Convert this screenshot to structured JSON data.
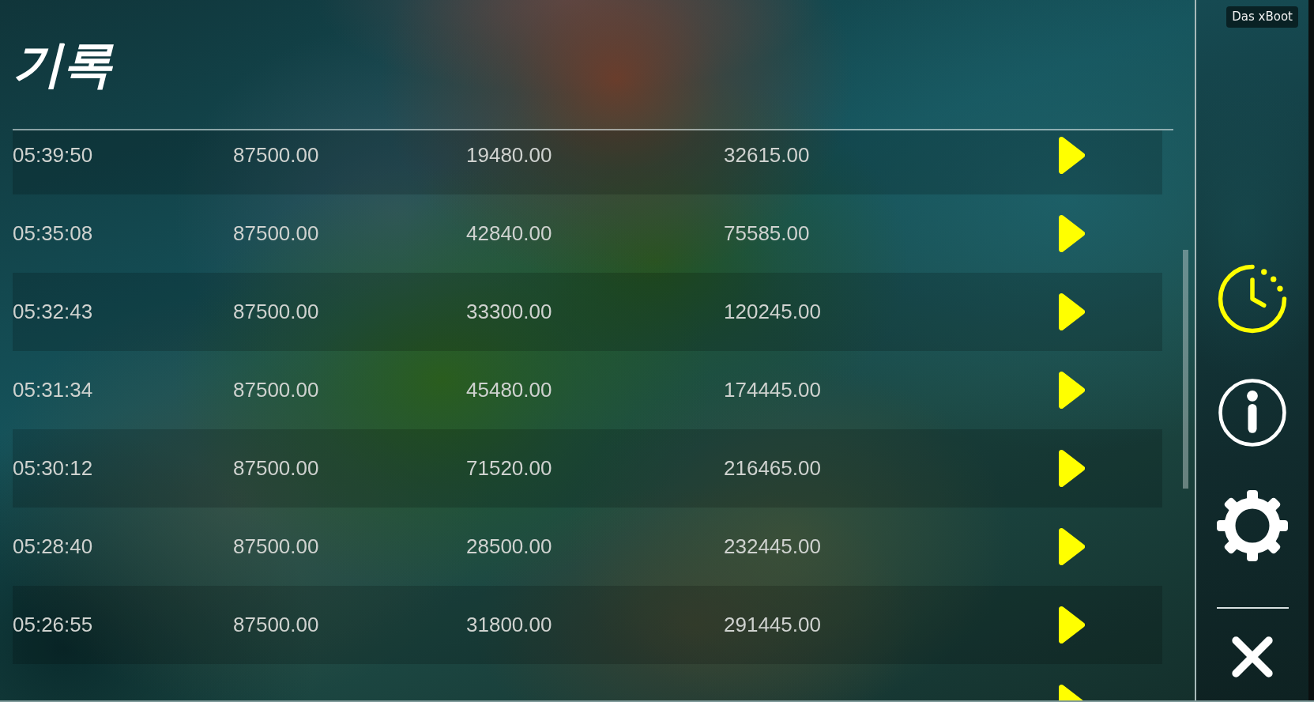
{
  "title": "기록",
  "rows": [
    {
      "column_1": "05:39:50",
      "column_2": "87500.00",
      "column_3": "19480.00",
      "column_4": "32615.00"
    },
    {
      "column_1": "05:35:08",
      "column_2": "87500.00",
      "column_3": "42840.00",
      "column_4": "75585.00"
    },
    {
      "column_1": "05:32:43",
      "column_2": "87500.00",
      "column_3": "33300.00",
      "column_4": "120245.00"
    },
    {
      "column_1": "05:31:34",
      "column_2": "87500.00",
      "column_3": "45480.00",
      "column_4": "174445.00"
    },
    {
      "column_1": "05:30:12",
      "column_2": "87500.00",
      "column_3": "71520.00",
      "column_4": "216465.00"
    },
    {
      "column_1": "05:28:40",
      "column_2": "87500.00",
      "column_3": "28500.00",
      "column_4": "232445.00"
    },
    {
      "column_1": "05:26:55",
      "column_2": "87500.00",
      "column_3": "31800.00",
      "column_4": "291445.00"
    }
  ],
  "sidebar": {
    "badge": "Das xBoot",
    "items": [
      {
        "kind": "history",
        "selected": true
      },
      {
        "kind": "info",
        "selected": false
      },
      {
        "kind": "settings",
        "selected": false
      },
      {
        "kind": "close",
        "selected": false
      }
    ]
  }
}
